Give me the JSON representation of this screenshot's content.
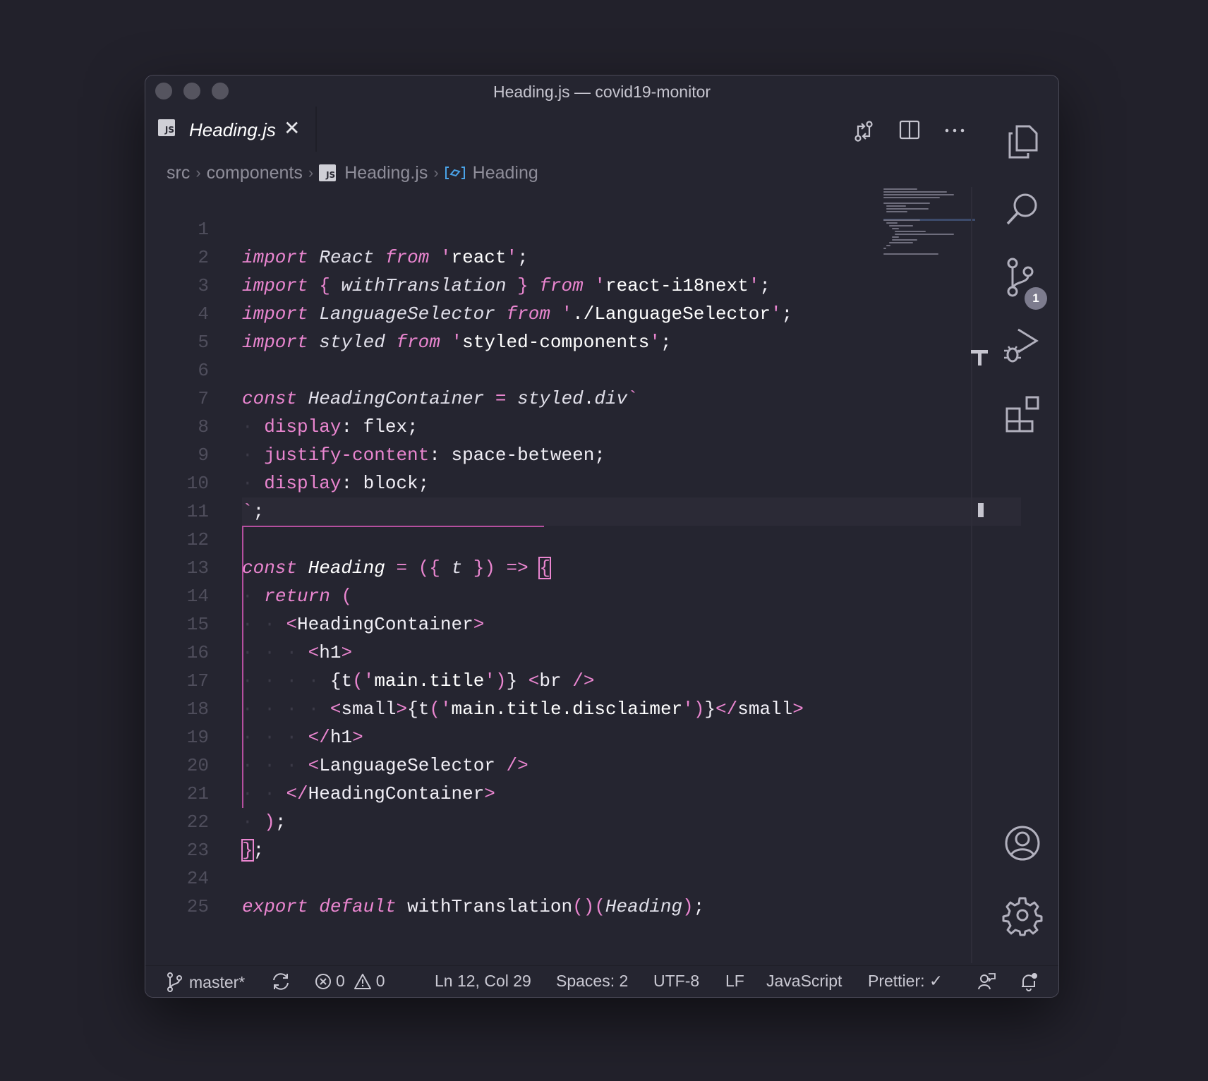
{
  "window": {
    "title": "Heading.js — covid19-monitor"
  },
  "tab": {
    "icon_label": "JS",
    "name": "Heading.js",
    "close": "✕"
  },
  "breadcrumbs": {
    "items": [
      "src",
      "components",
      "Heading.js",
      "Heading"
    ],
    "file_icon_label": "JS"
  },
  "editor_actions": [
    "compare-changes-icon",
    "split-editor-icon",
    "more-actions-icon"
  ],
  "code": {
    "lines": [
      {
        "n": "1"
      },
      {
        "n": "2"
      },
      {
        "n": "3"
      },
      {
        "n": "4"
      },
      {
        "n": "5"
      },
      {
        "n": "6"
      },
      {
        "n": "7"
      },
      {
        "n": "8"
      },
      {
        "n": "9"
      },
      {
        "n": "10"
      },
      {
        "n": "11"
      },
      {
        "n": "12"
      },
      {
        "n": "13"
      },
      {
        "n": "14"
      },
      {
        "n": "15"
      },
      {
        "n": "16"
      },
      {
        "n": "17"
      },
      {
        "n": "18"
      },
      {
        "n": "19"
      },
      {
        "n": "20"
      },
      {
        "n": "21"
      },
      {
        "n": "22"
      },
      {
        "n": "23"
      },
      {
        "n": "24"
      },
      {
        "n": "25"
      }
    ],
    "source": [
      "import React from 'react';",
      "import { withTranslation } from 'react-i18next';",
      "import LanguageSelector from './LanguageSelector';",
      "import styled from 'styled-components';",
      "",
      "const HeadingContainer = styled.div`",
      "  display: flex;",
      "  justify-content: space-between;",
      "  display: block;",
      "`;",
      "",
      "const Heading = ({ t }) => {",
      "  return (",
      "    <HeadingContainer>",
      "      <h1>",
      "        {t('main.title')} <br />",
      "        <small>{t('main.title.disclaimer')}</small>",
      "      </h1>",
      "      <LanguageSelector />",
      "    </HeadingContainer>",
      "  );",
      "};",
      "",
      "export default withTranslation()(Heading);",
      ""
    ]
  },
  "activity_bar": {
    "icons": [
      "explorer-icon",
      "search-icon",
      "source-control-icon",
      "run-debug-icon",
      "extensions-icon",
      "accounts-icon",
      "settings-gear-icon"
    ],
    "source_control_badge": "1"
  },
  "status_bar": {
    "branch": "master*",
    "errors": "0",
    "warnings": "0",
    "cursor": "Ln 12, Col 29",
    "spaces": "Spaces: 2",
    "encoding": "UTF-8",
    "eol": "LF",
    "language": "JavaScript",
    "formatter": "Prettier: ✓"
  },
  "colors": {
    "background": "#22212b",
    "editor": "#252530",
    "keyword": "#ea86d0",
    "string": "#ffffff",
    "line_number": "#4f4e5c",
    "badge": "#7d7c8e"
  }
}
